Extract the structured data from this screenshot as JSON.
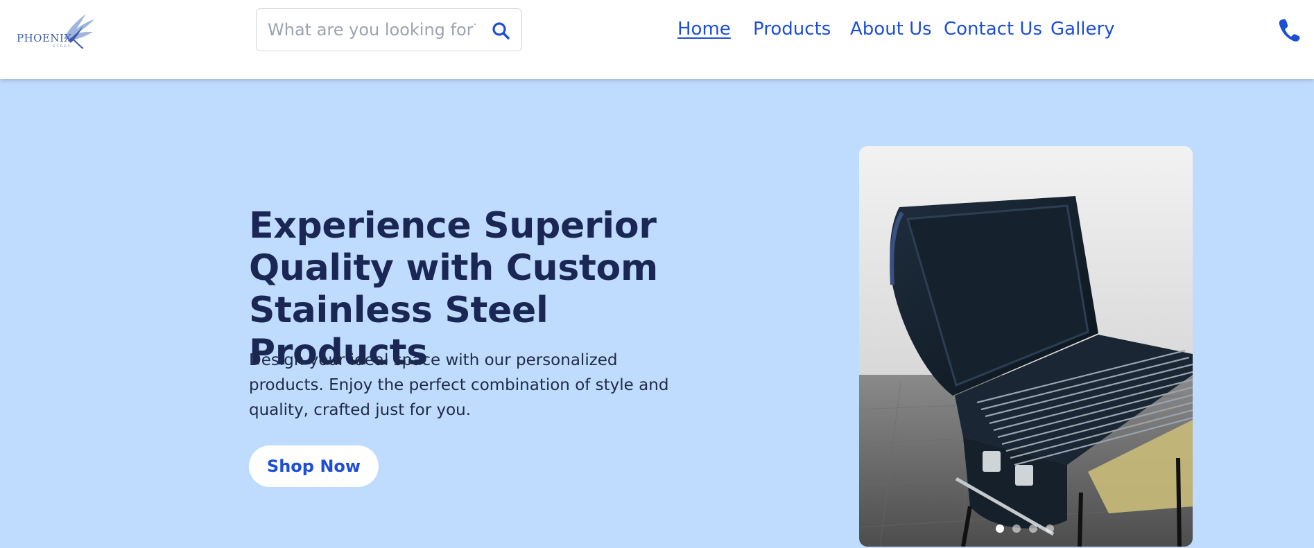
{
  "brand": {
    "name": "PHOENIX",
    "subtitle": "STEEL",
    "logo_icon": "phoenix-wing-icon",
    "color": "#3b5aa8"
  },
  "search": {
    "placeholder": "What are you looking for?",
    "value": "",
    "icon": "search-icon"
  },
  "nav": {
    "items": [
      {
        "label": "Home",
        "active": true
      },
      {
        "label": "Products",
        "active": false
      },
      {
        "label": "About Us",
        "active": false
      },
      {
        "label": "Contact Us",
        "active": false
      },
      {
        "label": "Gallery",
        "active": false
      }
    ],
    "phone_icon": "phone-icon",
    "link_color": "#1d4ed8"
  },
  "hero": {
    "title": "Experience Superior Quality with Custom Stainless Steel Products",
    "description": "Design your ideal space with our personalized products. Enjoy the perfect combination of style and quality, crafted just for you.",
    "cta_label": "Shop Now",
    "background": "#bfdbfe",
    "title_color": "#1a2755"
  },
  "carousel": {
    "image_subject": "barbecue-grill-image",
    "slide_count": 4,
    "active_slide": 1
  }
}
